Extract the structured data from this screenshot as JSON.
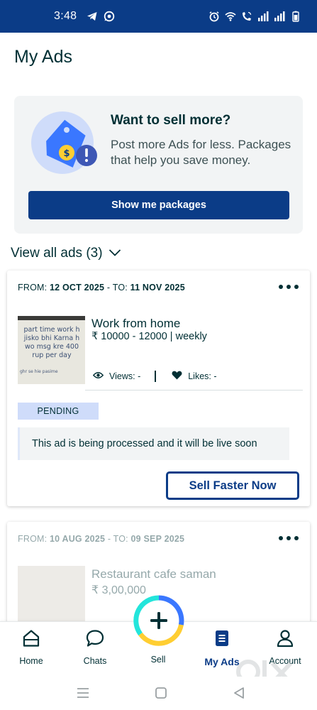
{
  "status_bar": {
    "time": "3:48"
  },
  "page": {
    "title": "My Ads"
  },
  "promo": {
    "title": "Want to sell more?",
    "description": "Post more Ads for less. Packages that help you save money.",
    "button_label": "Show me packages"
  },
  "view_all": {
    "label": "View all ads (3)"
  },
  "ads": [
    {
      "from_label": "FROM:",
      "from_date": "12 OCT 2025",
      "to_label": "- TO:",
      "to_date": "11 NOV 2025",
      "thumb_text": "part time work h jisko bhi Karna h wo msg kre 400 rup per day",
      "thumb_small_text": "ghr se hie pasime",
      "title": "Work from home",
      "price": "₹ 10000 - 12000 | weekly",
      "views_label": "Views: -",
      "likes_label": "Likes: -",
      "status": "PENDING",
      "notice": "This ad is being processed and it will be live soon",
      "action_label": "Sell Faster Now"
    },
    {
      "from_label": "FROM:",
      "from_date": "10 AUG 2025",
      "to_label": "- TO:",
      "to_date": "09 SEP 2025",
      "title": "Restaurant cafe saman",
      "price": "₹ 3,00,000"
    }
  ],
  "bottom_nav": {
    "home": "Home",
    "chats": "Chats",
    "sell": "Sell",
    "my_ads": "My Ads",
    "account": "Account",
    "active": "my_ads"
  },
  "colors": {
    "brand_blue": "#0b3c87",
    "text_dark": "#002f34",
    "pending_bg": "#cfdcfa",
    "card_bg": "#f2f4f5",
    "sell_ring_yellow": "#ffce32",
    "sell_ring_blue": "#3a77ff",
    "sell_ring_teal": "#23e5db"
  },
  "icons": [
    "telegram-icon",
    "whatsapp-icon",
    "alarm-icon",
    "wifi-icon",
    "wifi-call-icon",
    "signal-icon",
    "battery-icon",
    "more-icon",
    "eye-icon",
    "heart-icon",
    "chevron-down-icon",
    "home-icon",
    "chat-icon",
    "plus-icon",
    "my-ads-icon",
    "user-icon"
  ]
}
